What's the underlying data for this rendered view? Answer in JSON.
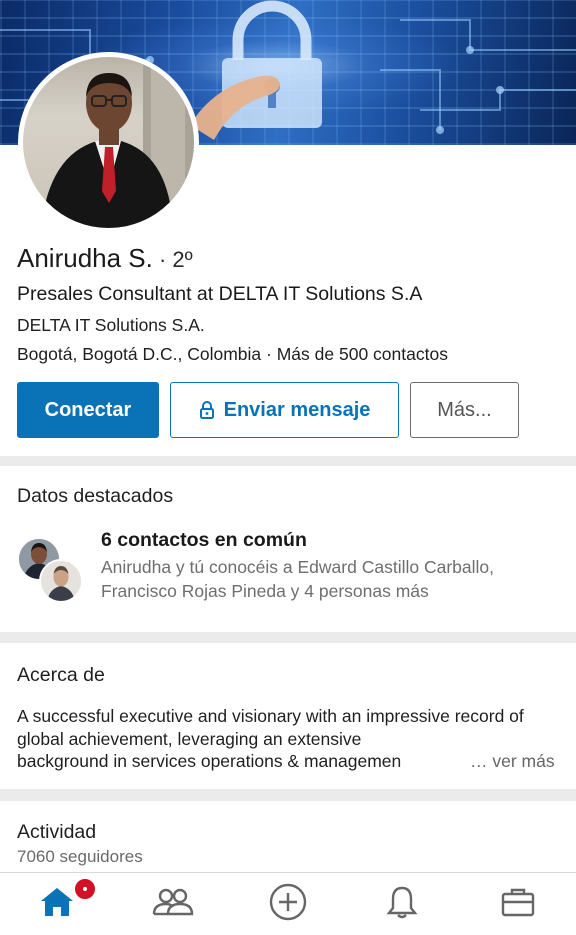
{
  "profile": {
    "name": "Anirudha S.",
    "degree": " · 2º",
    "headline": "Presales Consultant at DELTA IT Solutions S.A",
    "company": "DELTA IT Solutions S.A.",
    "location": "Bogotá, Bogotá D.C., Colombia",
    "location_separator": " · ",
    "connections": "Más de 500 contactos"
  },
  "actions": {
    "connect_label": "Conectar",
    "message_label": "Enviar mensaje",
    "more_label": "Más..."
  },
  "highlights": {
    "title": "Datos destacados",
    "mutual_title": "6 contactos en común",
    "mutual_desc": "Anirudha y tú conocéis a Edward Castillo Carballo, Francisco Rojas Pineda y 4 personas más"
  },
  "about": {
    "title": "Acerca de",
    "text_visible": "A successful executive and visionary with an impressive record of global achievement, leveraging an extensive",
    "text_truncated": "background in services operations & managemen",
    "see_more": "… ver más"
  },
  "activity": {
    "title": "Actividad",
    "followers": "7060 seguidores"
  },
  "nav": {
    "items": [
      {
        "icon": "home-icon",
        "active": true
      },
      {
        "icon": "my-network-icon",
        "active": false
      },
      {
        "icon": "post-plus-icon",
        "active": false
      },
      {
        "icon": "bell-icon",
        "active": false
      },
      {
        "icon": "briefcase-icon",
        "active": false
      }
    ],
    "notification_badge": "•"
  },
  "colors": {
    "primary": "#0a73b7",
    "badge": "#d11124",
    "icon_gray": "#666666"
  }
}
